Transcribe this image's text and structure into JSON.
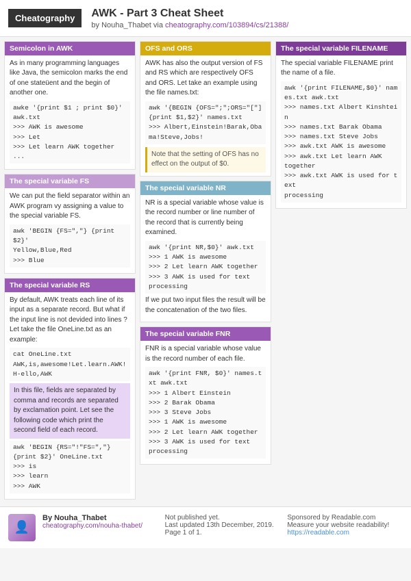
{
  "header": {
    "logo": "Cheatography",
    "title": "AWK - Part 3 Cheat Sheet",
    "subtitle": "by Nouha_Thabet via cheatography.com/103894/cs/21388/",
    "subtitle_link": "cheatography.com/103894/cs/21388/"
  },
  "sections": {
    "semicolon": {
      "header": "Semicolon in AWK",
      "body": "As in many programming languages like Java, the semicolon marks the end of one stateüent and the begin of another one.",
      "code": "awke '{print $1 ; print $0}'\nawk.txt\n>>> AWK is awesome\n>>> Let\n>>> Let learn AWK together\n..."
    },
    "special_fs": {
      "header": "The special variable FS",
      "body": "We can put the field separator within an AWK program vy assigning a value to the special variable FS.",
      "code": "awk 'BEGIN {FS=\",\"} {print $2}'\nYellow,Blue,Red\n>>> Blue"
    },
    "special_rs": {
      "header": "The special variable RS",
      "body": "By default, AWK treats each line of its input as a separate record. But what if the input line is not devided into lines ? Let take the file OneLine.txt as an example:",
      "code1": "cat OneLine.txt\nAWK,is,awesome!Let.learn.AWK!H-ello,AWK",
      "highlight": "In this file, fields are separated by comma and records are separated by exclamation point. Let see the following code which print the second field of each record.",
      "code2": "awk 'BEGIN {RS=\"!\"FS=\",\"}\n{print $2}' OneLine.txt\n>>> is\n>>> learn\n>>> AWK"
    },
    "ofs_ors": {
      "header": "OFS and ORS",
      "body": "AWK has also the output version of FS and RS which are respectively OFS and ORS. Let take an example using the file names.txt:",
      "code1": "awk '{BEGIN {OFS=\";\";ORS=\"[\"] {print $1,$2}' names.txt\n>>> Albert,Einstein!Barak,Obama!Steve,Jobs!",
      "note": "Note that the setting of OFS has no effect on the output of $0."
    },
    "special_nr": {
      "header": "The special variable NR",
      "body": "NR is a special variable whose value is the record number or line number of the record that is currently being examined.",
      "code": "awk '{print NR,$0}' awk.txt\n>>> 1 AWK is awesome\n>>> 2 Let learn AWK together\n>>> 3 AWK is used for text\nprocessing",
      "body2": "If we put two input files the result will be the concatenation of the two files."
    },
    "special_fnr": {
      "header": "The special variable FNR",
      "body": "FNR is a special variable whose value is the record number of each file.",
      "code": "awk '{print FNR, $0}' names.txt awk.txt\n>>> 1 Albert Einstein\n>>> 2 Barak Obama\n>>> 3 Steve Jobs\n>>> 1 AWK is awesome\n>>> 2 Let learn AWK together\n>>> 3 AWK is used for text\nprocessing"
    },
    "special_filename": {
      "header": "The special variable FILENAME",
      "body": "The special variable FILENAME print the name of a file.",
      "code": "awk '{print FILENAME,$0}' names.txt awk.txt\n>>> names.txt Albert Kinshtein\n>>> names.txt Barak Obama\n>>> names.txt Steve Jobs\n>>> awk.txt AWK is awesome\n>>> awk.txt Let learn AWK\ntogether\n>>> awk.txt AWK is used for text\nprocessing"
    }
  },
  "footer": {
    "author": "By Nouha_Thabet",
    "author_link": "cheatography.com/nouha-thabet/",
    "status": "Not published yet.",
    "updated": "Last updated 13th December, 2019.",
    "page": "Page 1 of 1.",
    "sponsor_title": "Sponsored by Readable.com",
    "sponsor_desc": "Measure your website readability!",
    "sponsor_link": "https://readable.com"
  }
}
